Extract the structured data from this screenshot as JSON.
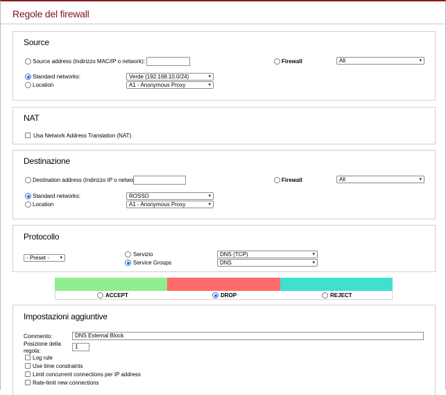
{
  "page": {
    "title": "Regole del firewall"
  },
  "source": {
    "title": "Source",
    "address_label": "Source address (Indirizzo MAC/IP o network):",
    "address_value": "",
    "firewall_label": "Firewall",
    "firewall_select": "All",
    "standard_label": "Standard networks:",
    "standard_select": "Verde (192.168.10.0/24)",
    "location_label": "Location",
    "location_select": "A1 - Anonymous Proxy",
    "selected": "standard"
  },
  "nat": {
    "title": "NAT",
    "checkbox_label": "Usa Network Address Translation (NAT)",
    "checked": false
  },
  "destination": {
    "title": "Destinazione",
    "address_label": "Destination address (Indirizzo IP o network):",
    "address_value": "",
    "firewall_label": "Firewall",
    "firewall_select": "All",
    "standard_label": "Standard networks:",
    "standard_select": "ROSSO",
    "location_label": "Location",
    "location_select": "A1 - Anonymous Proxy",
    "selected": "standard"
  },
  "protocol": {
    "title": "Protocollo",
    "preset_select": "- Preset -",
    "service_label": "Servizio",
    "service_select": "DNS (TCP)",
    "groups_label": "Service Groups",
    "groups_select": "DNS",
    "selected": "groups"
  },
  "action": {
    "options": [
      {
        "label": "ACCEPT",
        "color": "#90ee90",
        "selected": false
      },
      {
        "label": "DROP",
        "color": "#ff6b6b",
        "selected": true
      },
      {
        "label": "REJECT",
        "color": "#40e0d0",
        "selected": false
      }
    ]
  },
  "extra": {
    "title": "Impostazioni aggiuntive",
    "comment_label": "Commento:",
    "comment_value": "DNS Esternal Block",
    "position_label_1": "Posizione della",
    "position_label_2": "regola:",
    "position_value": "1",
    "checkboxes": [
      {
        "label": "Log rule",
        "checked": false
      },
      {
        "label": "Use time constraints",
        "checked": false
      },
      {
        "label": "Limit concurrent connections per IP address",
        "checked": false
      },
      {
        "label": "Rate-limit new connections",
        "checked": false
      }
    ]
  },
  "icons": {
    "dropdown": "chevron-down-icon"
  },
  "colors": {
    "title": "#7a1418",
    "header_border": "#8b1a1a",
    "radio_accent": "#2a6ad1"
  }
}
